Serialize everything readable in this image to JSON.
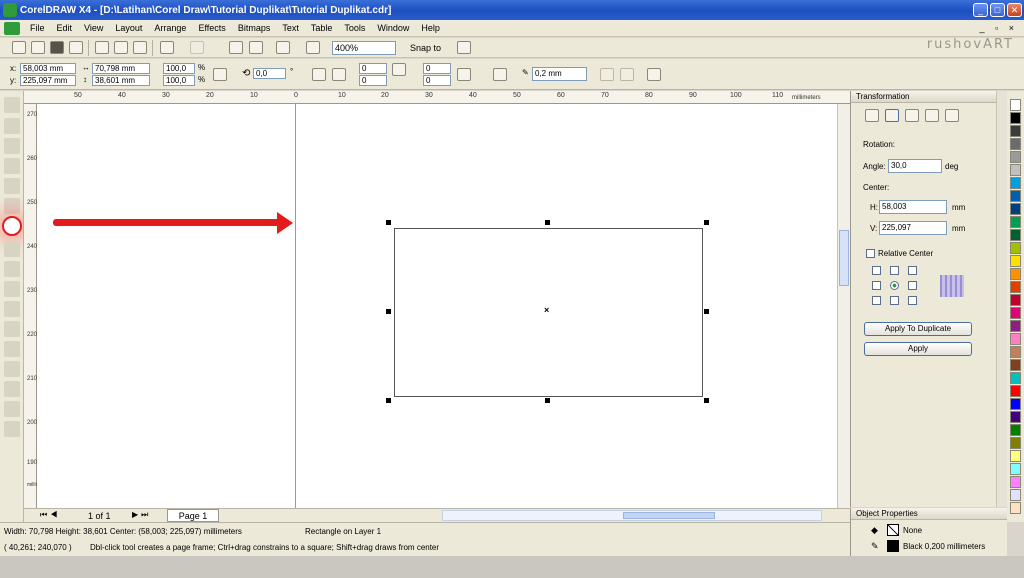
{
  "app": {
    "title": "CorelDRAW X4 - [D:\\Latihan\\Corel Draw\\Tutorial Duplikat\\Tutorial Duplikat.cdr]",
    "watermark": "rushovART"
  },
  "menu": [
    "File",
    "Edit",
    "View",
    "Layout",
    "Arrange",
    "Effects",
    "Bitmaps",
    "Text",
    "Table",
    "Tools",
    "Window",
    "Help"
  ],
  "toolbar": {
    "zoom": "400%",
    "snap_to": "Snap to"
  },
  "propbar": {
    "x": "58,003 mm",
    "y": "225,097 mm",
    "w": "70,798 mm",
    "h": "38,601 mm",
    "scale_x": "100,0",
    "scale_y": "100,0",
    "pct": "%",
    "angle": "0,0",
    "deg": "°",
    "corner_tl": "0",
    "corner_bl": "0",
    "corner_tr": "0",
    "corner_br": "0",
    "outline": "0,2 mm"
  },
  "ruler": {
    "h_ticks": [
      "50",
      "40",
      "30",
      "20",
      "10",
      "0",
      "10",
      "20",
      "30",
      "40",
      "50",
      "60",
      "70",
      "80",
      "90",
      "100",
      "110"
    ],
    "h_unit": "millimeters",
    "v_ticks": [
      "270",
      "260",
      "250",
      "240",
      "230",
      "220",
      "210",
      "200",
      "190"
    ],
    "v_unit": "millimeters"
  },
  "pages": {
    "count": "1 of 1",
    "tab": "Page 1"
  },
  "transformation": {
    "header": "Transformation",
    "rotation": "Rotation:",
    "angle_label": "Angle:",
    "angle": "30,0",
    "deg": "deg",
    "center": "Center:",
    "h_label": "H:",
    "h": "58,003",
    "v_label": "V:",
    "v": "225,097",
    "mm": "mm",
    "relative_center": "Relative Center",
    "apply_dup": "Apply To Duplicate",
    "apply": "Apply"
  },
  "object_props": {
    "header": "Object Properties",
    "fill": "None",
    "outline": "Black  0,200 millimeters"
  },
  "status": {
    "line1": "Width: 70,798  Height: 38,601  Center: (58,003; 225,097)  millimeters",
    "layer": "Rectangle on Layer 1",
    "coords": "( 40,261; 240,070 )",
    "hint": "Dbl-click tool creates a page frame; Ctrl+drag constrains to a square; Shift+drag draws from center"
  },
  "palette": [
    "#ffffff",
    "#000000",
    "#3b3b3b",
    "#6b6b6b",
    "#9a9a9a",
    "#c0c0c0",
    "#00a0e0",
    "#0060b0",
    "#004080",
    "#00a050",
    "#006030",
    "#a0c000",
    "#ffe000",
    "#ff9000",
    "#e04000",
    "#c00030",
    "#e0007a",
    "#8a2080",
    "#ff80c0",
    "#c08060",
    "#804020",
    "#00c0c0",
    "#ff0000",
    "#0000ff",
    "#400080",
    "#008000",
    "#808000",
    "#ffff80",
    "#80ffff",
    "#ff80ff",
    "#e0e0ff",
    "#ffe0c0"
  ],
  "colors": {
    "accent": "#e31b1b",
    "selection": "#000000"
  }
}
